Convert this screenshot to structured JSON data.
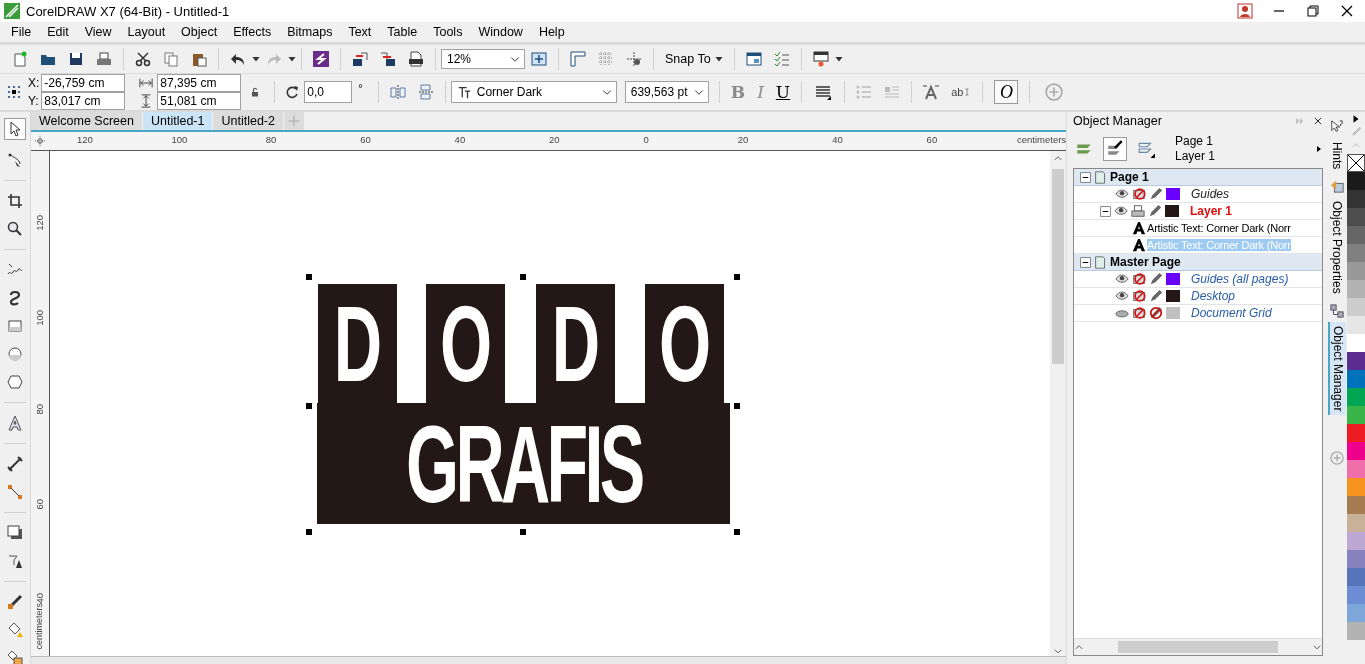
{
  "window": {
    "title": "CorelDRAW X7 (64-Bit) - Untitled-1"
  },
  "menu": [
    "File",
    "Edit",
    "View",
    "Layout",
    "Object",
    "Effects",
    "Bitmaps",
    "Text",
    "Table",
    "Tools",
    "Window",
    "Help"
  ],
  "toolbar": {
    "zoom": "12%",
    "snap": "Snap To"
  },
  "property_bar": {
    "x_label": "X:",
    "x": "-26,759 cm",
    "y_label": "Y:",
    "y": "83,017 cm",
    "width": "87,395 cm",
    "height": "51,081 cm",
    "rotation": "0,0",
    "degree": "°",
    "font": "Corner Dark",
    "font_size": "639,563 pt",
    "styles": [
      {
        "label": "B",
        "kind": "bold",
        "disabled": true
      },
      {
        "label": "I",
        "kind": "italic",
        "disabled": true
      },
      {
        "label": "U",
        "kind": "underline",
        "disabled": false
      }
    ],
    "frame_text": "ab",
    "opentype": "O"
  },
  "document_tabs": [
    {
      "label": "Welcome Screen",
      "selected": false
    },
    {
      "label": "Untitled-1",
      "selected": true
    },
    {
      "label": "Untitled-2",
      "selected": false
    }
  ],
  "rulers": {
    "horizontal": [
      "120",
      "100",
      "80",
      "60",
      "40",
      "20",
      "0",
      "20",
      "40",
      "60"
    ],
    "horizontal_unit": "centimeters",
    "vertical": [
      "120",
      "100",
      "80",
      "60",
      "40"
    ],
    "vertical_unit": "centimeters"
  },
  "artwork": {
    "top_letters": [
      "D",
      "O",
      "D",
      "O"
    ],
    "bottom_text": "GRAFIS"
  },
  "object_manager": {
    "title": "Object Manager",
    "page": "Page 1",
    "layer": "Layer 1",
    "tree": [
      {
        "label": "Page 1",
        "kind": "page",
        "expanded": true,
        "selected": false,
        "children": [
          {
            "label": "Guides",
            "kind": "layer",
            "current": false,
            "selected": false,
            "visible": true,
            "printable": false,
            "editable": true,
            "color": "#6a00ff"
          },
          {
            "label": "Layer 1",
            "kind": "layer",
            "current": true,
            "selected": false,
            "expanded": true,
            "visible": true,
            "printable": true,
            "editable": true,
            "color": "#231815",
            "children": [
              {
                "label": "Artistic Text: Corner Dark (Norr",
                "kind": "object",
                "selected": false
              },
              {
                "label": "Artistic Text: Corner Dark (Norr",
                "kind": "object",
                "selected": true
              }
            ]
          }
        ]
      },
      {
        "label": "Master Page",
        "kind": "page",
        "expanded": true,
        "selected": false,
        "children": [
          {
            "label": "Guides (all pages)",
            "kind": "master-layer",
            "current": false,
            "selected": false,
            "visible": true,
            "printable": false,
            "editable": true,
            "color": "#6a00ff"
          },
          {
            "label": "Desktop",
            "kind": "master-layer",
            "current": false,
            "selected": false,
            "visible": true,
            "printable": false,
            "editable": true,
            "color": "#231815"
          },
          {
            "label": "Document Grid",
            "kind": "master-layer",
            "current": false,
            "selected": false,
            "visible": false,
            "printable": false,
            "editable": false,
            "color": "#c0c0c0"
          }
        ]
      }
    ]
  },
  "docker_tabs": [
    {
      "label": "Hints",
      "selected": false
    },
    {
      "label": "Object Properties",
      "selected": false
    },
    {
      "label": "Object Manager",
      "selected": true
    }
  ],
  "palette": [
    {
      "kind": "none"
    },
    {
      "kind": "swatch",
      "color": "#1a1a1a"
    },
    {
      "kind": "swatch",
      "color": "#333333"
    },
    {
      "kind": "swatch",
      "color": "#4d4d4d"
    },
    {
      "kind": "swatch",
      "color": "#666666"
    },
    {
      "kind": "swatch",
      "color": "#808080"
    },
    {
      "kind": "swatch",
      "color": "#999999"
    },
    {
      "kind": "swatch",
      "color": "#b3b3b3"
    },
    {
      "kind": "swatch",
      "color": "#cccccc"
    },
    {
      "kind": "swatch",
      "color": "#e6e6e6"
    },
    {
      "kind": "swatch",
      "color": "#ffffff"
    },
    {
      "kind": "swatch",
      "color": "#5c2d91"
    },
    {
      "kind": "swatch",
      "color": "#0072bc"
    },
    {
      "kind": "swatch",
      "color": "#00a651"
    },
    {
      "kind": "swatch",
      "color": "#39b54a"
    },
    {
      "kind": "swatch",
      "color": "#ed1c24"
    },
    {
      "kind": "swatch",
      "color": "#ec008c"
    },
    {
      "kind": "swatch",
      "color": "#f06eaa"
    },
    {
      "kind": "swatch",
      "color": "#f7941d"
    },
    {
      "kind": "swatch",
      "color": "#a67c52"
    },
    {
      "kind": "swatch",
      "color": "#c7b299"
    },
    {
      "kind": "swatch",
      "color": "#bda8d3"
    },
    {
      "kind": "swatch",
      "color": "#8781bd"
    },
    {
      "kind": "swatch",
      "color": "#5674b9"
    },
    {
      "kind": "swatch",
      "color": "#6c8cd5"
    },
    {
      "kind": "swatch",
      "color": "#7da7d9"
    },
    {
      "kind": "swatch",
      "color": "#b3b3b3"
    }
  ]
}
